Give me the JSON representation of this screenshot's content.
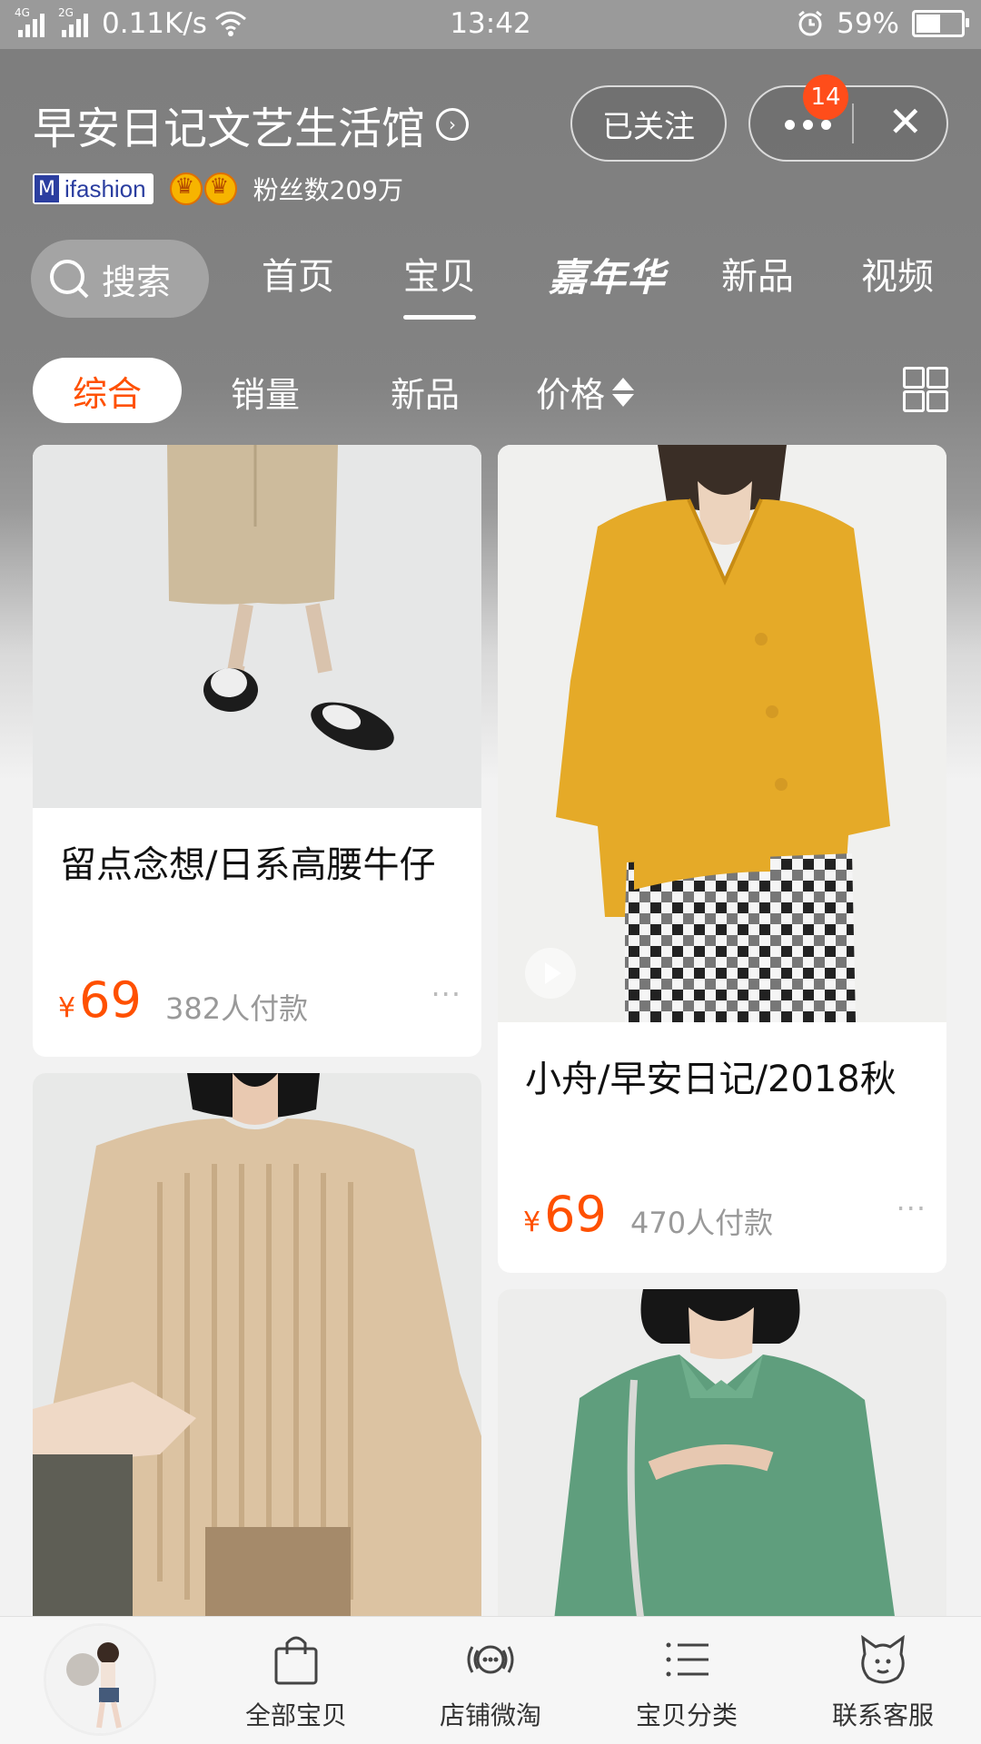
{
  "status": {
    "speed": "0.11K/s",
    "time": "13:42",
    "battery": "59%",
    "battery_level": 0.59,
    "net1": "4G",
    "net2": "2G"
  },
  "shop": {
    "name": "早安日记文艺生活馆",
    "brand": "ifashion",
    "fans": "粉丝数209万",
    "follow_label": "已关注",
    "badge_count": "14"
  },
  "nav": {
    "search_label": "搜索",
    "home": "首页",
    "items": "宝贝",
    "carnival": "嘉年华",
    "new": "新品",
    "video": "视频"
  },
  "sort": {
    "overall": "综合",
    "sales": "销量",
    "new": "新品",
    "price": "价格"
  },
  "products": [
    {
      "title": "留点念想/日系高腰牛仔",
      "currency": "¥",
      "price": "69",
      "sold": "382人付款",
      "more": "···"
    },
    {
      "title": "小舟/早安日记/2018秋",
      "currency": "¥",
      "price": "69",
      "sold": "470人付款",
      "more": "···"
    }
  ],
  "tabs": {
    "all": "全部宝贝",
    "weitao": "店铺微淘",
    "categories": "宝贝分类",
    "service": "联系客服"
  },
  "colors": {
    "accent": "#ff5000",
    "badge": "#ff4d1a"
  }
}
